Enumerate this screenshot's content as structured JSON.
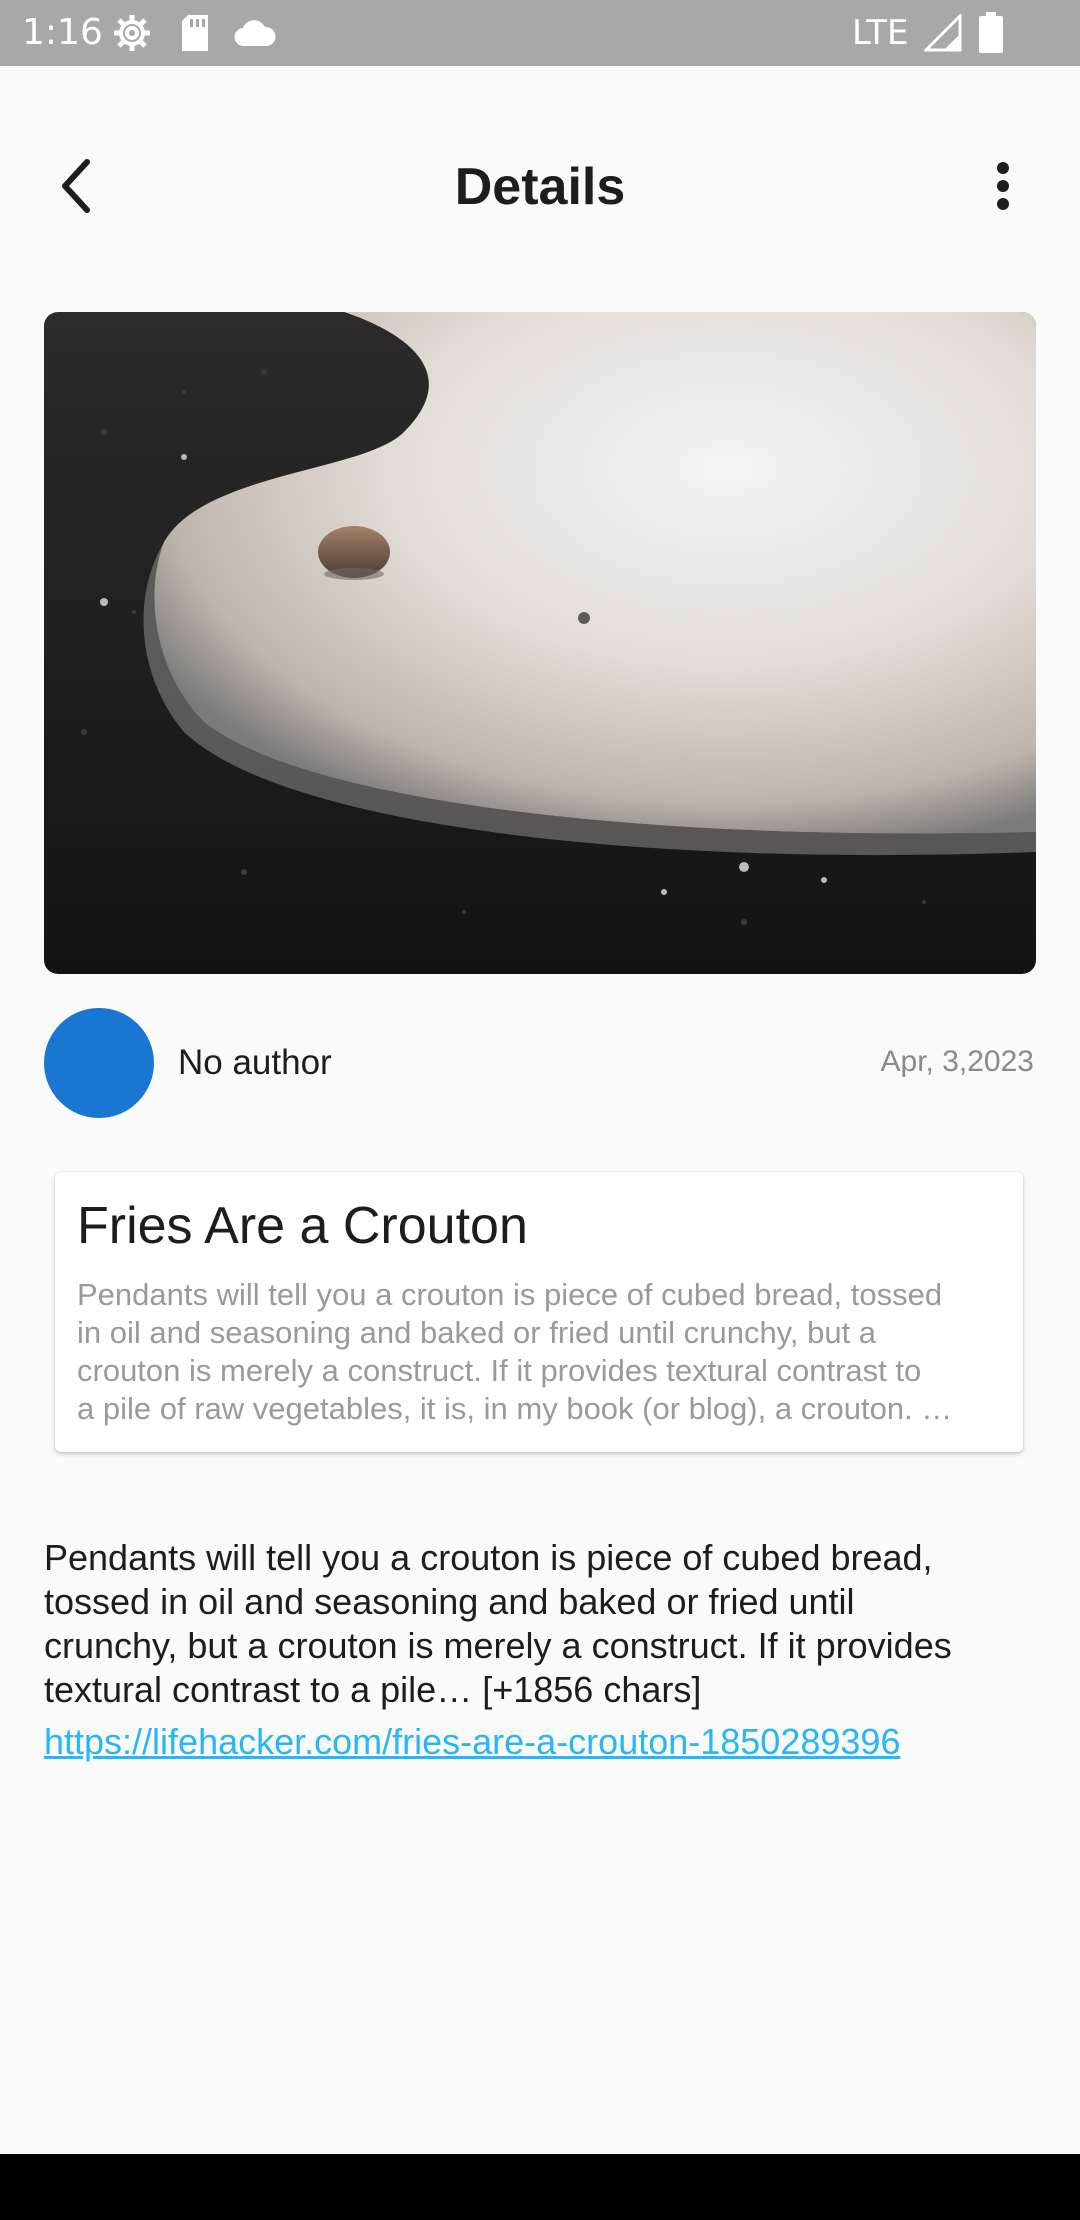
{
  "status_bar": {
    "time": "1:16",
    "network": "LTE",
    "icons": [
      "settings-icon",
      "sd-card-icon",
      "cloud-icon",
      "signal-icon",
      "battery-icon"
    ]
  },
  "app_bar": {
    "title": "Details",
    "back_icon": "chevron-left-icon",
    "menu_icon": "more-vert-icon"
  },
  "article": {
    "author": "No author",
    "date": "Apr, 3,2023",
    "title": "Fries Are a Crouton",
    "description_lines": [
      "Pendants will tell you a crouton is piece of cubed bread, tossed",
      "in oil and seasoning and baked or fried until crunchy, but a",
      "crouton is merely a construct. If it provides textural contrast to",
      "a pile of raw vegetables, it is, in my book (or blog), a crouton. …"
    ],
    "content_lines": [
      "Pendants will tell you a crouton is piece of cubed bread,",
      "tossed in oil and seasoning and baked or fried until",
      "crunchy, but a crouton is merely a construct. If it provides",
      "textural contrast to a pile… [+1856 chars]"
    ],
    "url": "https://lifehacker.com/fries-are-a-crouton-1850289396"
  },
  "colors": {
    "status_bar": "#a8a8a8",
    "background": "#fafafa",
    "avatar": "#1976d2",
    "link": "#29b6f6",
    "date": "#8a8a8a",
    "description": "#9a9a9a"
  }
}
